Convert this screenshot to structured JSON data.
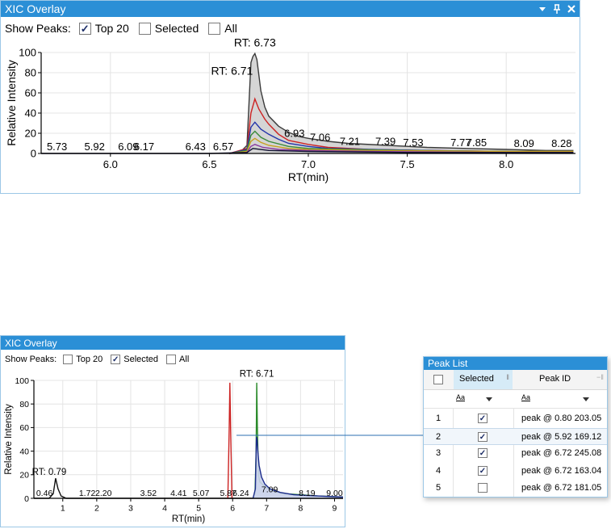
{
  "top_panel": {
    "title": "XIC Overlay",
    "show_peaks_label": "Show Peaks:",
    "options": [
      {
        "label": "Top 20",
        "checked": true
      },
      {
        "label": "Selected",
        "checked": false
      },
      {
        "label": "All",
        "checked": false
      }
    ],
    "icons": [
      "dropdown-icon",
      "pin-icon",
      "close-icon"
    ],
    "chart": {
      "ylabel": "Relative Intensity",
      "xlabel": "RT(min)",
      "xlim": [
        5.65,
        8.35
      ],
      "ylim": [
        0,
        100
      ],
      "yticks": [
        "0",
        "20",
        "40",
        "60",
        "80",
        "100"
      ],
      "xticks": [
        "6.0",
        "6.5",
        "7.0",
        "7.5",
        "8.0"
      ],
      "peak_labels": [
        "5.73",
        "5.92",
        "6.09",
        "6.17",
        "6.43",
        "6.57",
        "6.93",
        "7.06",
        "7.21",
        "7.39",
        "7.53",
        "7.77",
        "7.85",
        "8.09",
        "8.28"
      ],
      "rt_labels": [
        "RT: 6.73",
        "RT: 6.71"
      ]
    }
  },
  "bottom_panel": {
    "title": "XIC Overlay",
    "show_peaks_label": "Show Peaks:",
    "options": [
      {
        "label": "Top 20",
        "checked": false
      },
      {
        "label": "Selected",
        "checked": true
      },
      {
        "label": "All",
        "checked": false
      }
    ],
    "chart": {
      "ylabel": "Relative Intensity",
      "xlabel": "RT(min)",
      "xlim": [
        0.15,
        9.25
      ],
      "ylim": [
        0,
        100
      ],
      "yticks": [
        "0",
        "20",
        "40",
        "60",
        "80",
        "100"
      ],
      "xticks": [
        "1",
        "2",
        "3",
        "4",
        "5",
        "6",
        "7",
        "8",
        "9"
      ],
      "peak_labels": [
        "0.46",
        "1.72",
        "2.20",
        "3.52",
        "4.41",
        "5.07",
        "5.87",
        "6.24",
        "7.09",
        "8.19",
        "9.00"
      ],
      "rt_labels": [
        "RT: 6.71",
        "RT: 0.79"
      ]
    }
  },
  "peak_list": {
    "title": "Peak List",
    "col_selected": "Selected",
    "col_peak_id": "Peak ID",
    "filter_aa": "Aa",
    "rows": [
      {
        "num": "1",
        "checked": true,
        "peak": "peak @ 0.80 203.05"
      },
      {
        "num": "2",
        "checked": true,
        "peak": "peak @ 5.92 169.12"
      },
      {
        "num": "3",
        "checked": true,
        "peak": "peak @ 6.72 245.08"
      },
      {
        "num": "4",
        "checked": true,
        "peak": "peak @ 6.72 163.04"
      },
      {
        "num": "5",
        "checked": false,
        "peak": "peak @ 6.72 181.05"
      }
    ]
  },
  "chart_data": [
    {
      "type": "line",
      "title": "",
      "xlabel": "RT(min)",
      "ylabel": "Relative Intensity",
      "xlim": [
        5.65,
        8.35
      ],
      "ylim": [
        0,
        100
      ],
      "grid": true,
      "series": [
        {
          "color": "#3a3a3a",
          "fill": "#d0d0d0",
          "x": [
            6.6,
            6.66,
            6.69,
            6.71,
            6.72,
            6.73,
            6.74,
            6.76,
            6.78,
            6.8,
            6.85,
            6.9,
            6.95,
            7.0,
            7.1,
            7.2,
            7.4,
            7.6,
            7.8,
            8.0,
            8.2,
            8.34
          ],
          "y": [
            0,
            2,
            8,
            90,
            96,
            99,
            93,
            62,
            46,
            37,
            27,
            21,
            17,
            15,
            12,
            10,
            8,
            6,
            5,
            4,
            3,
            3
          ]
        },
        {
          "color": "#cc2222",
          "x": [
            6.6,
            6.69,
            6.71,
            6.73,
            6.75,
            6.78,
            6.8,
            6.85,
            6.9,
            7.0,
            7.1,
            7.3,
            7.6,
            8.0,
            8.34
          ],
          "y": [
            0,
            5,
            40,
            54,
            44,
            34,
            29,
            19,
            13,
            9,
            6,
            4,
            3,
            2,
            2
          ]
        },
        {
          "color": "#2233aa",
          "x": [
            6.6,
            6.69,
            6.71,
            6.73,
            6.76,
            6.8,
            6.85,
            6.9,
            7.0,
            7.1,
            7.3,
            7.6,
            8.0,
            8.34
          ],
          "y": [
            0,
            4,
            26,
            31,
            24,
            19,
            14,
            10,
            7,
            5,
            4,
            3,
            2,
            2
          ]
        },
        {
          "color": "#3a8a3a",
          "x": [
            6.6,
            6.69,
            6.71,
            6.73,
            6.76,
            6.8,
            6.9,
            7.0,
            7.2,
            7.5,
            8.0,
            8.34
          ],
          "y": [
            0,
            3,
            18,
            22,
            16,
            12,
            7,
            5,
            4,
            3,
            2,
            2
          ]
        },
        {
          "color": "#c8a020",
          "x": [
            6.6,
            6.69,
            6.71,
            6.73,
            6.76,
            6.8,
            6.9,
            7.0,
            7.3,
            8.0,
            8.34
          ],
          "y": [
            0,
            2,
            12,
            15,
            11,
            8,
            5,
            4,
            3,
            2,
            2
          ]
        },
        {
          "color": "#8a3aa0",
          "x": [
            6.6,
            6.69,
            6.71,
            6.73,
            6.77,
            6.85,
            7.0,
            7.3,
            8.0,
            8.34
          ],
          "y": [
            0,
            1,
            7,
            9,
            6,
            4,
            3,
            2,
            1,
            1
          ]
        },
        {
          "color": "#101030",
          "x": [
            5.65,
            6.0,
            6.5,
            6.69,
            6.72,
            6.8,
            7.0,
            7.5,
            8.0,
            8.34
          ],
          "y": [
            0,
            0,
            0,
            1,
            5,
            3,
            2,
            1,
            1,
            1
          ]
        }
      ]
    },
    {
      "type": "line",
      "title": "",
      "xlabel": "RT(min)",
      "ylabel": "Relative Intensity",
      "xlim": [
        0.15,
        9.25
      ],
      "ylim": [
        0,
        100
      ],
      "grid": true,
      "series": [
        {
          "color": "#111111",
          "x": [
            0.15,
            0.6,
            0.72,
            0.79,
            0.86,
            0.95,
            1.1,
            9.25
          ],
          "y": [
            0,
            0,
            4,
            17,
            8,
            2,
            0,
            0
          ]
        },
        {
          "color": "#cc2222",
          "x": [
            5.86,
            5.9,
            5.92,
            5.94,
            5.98
          ],
          "y": [
            0,
            60,
            98,
            60,
            0
          ]
        },
        {
          "color": "#2a8a2a",
          "x": [
            6.6,
            6.66,
            6.69,
            6.71,
            6.73,
            6.76,
            6.8,
            6.9,
            7.0,
            7.2,
            7.5,
            8.0,
            8.5,
            9.25
          ],
          "y": [
            0,
            5,
            40,
            98,
            60,
            20,
            14,
            11,
            9,
            6,
            4,
            3,
            2,
            1
          ]
        },
        {
          "color": "#1a2a8a",
          "fill": "#c8d0ea",
          "x": [
            6.6,
            6.67,
            6.7,
            6.72,
            6.74,
            6.78,
            6.85,
            6.95,
            7.1,
            7.4,
            7.8,
            8.5,
            9.25
          ],
          "y": [
            0,
            8,
            52,
            50,
            40,
            28,
            18,
            12,
            8,
            5,
            3,
            2,
            1
          ]
        }
      ]
    }
  ]
}
